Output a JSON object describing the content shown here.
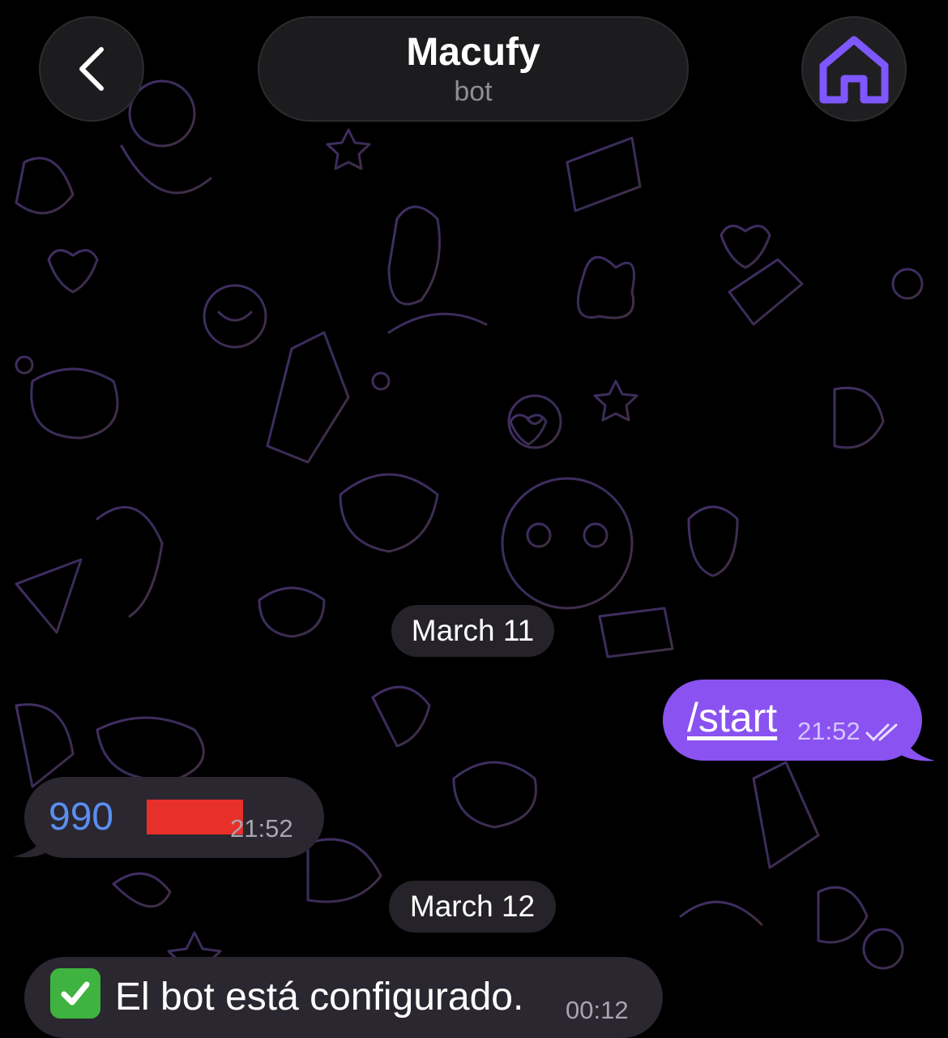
{
  "header": {
    "title": "Macufy",
    "subtitle": "bot",
    "back_icon": "chevron-left-icon",
    "home_icon": "home-icon",
    "accent_color": "#7e57ff"
  },
  "messages": [
    {
      "type": "date",
      "label": "March 11"
    },
    {
      "type": "outgoing",
      "text": "/start",
      "time": "21:52",
      "status": "read",
      "bubble_color": "#8a52f0"
    },
    {
      "type": "incoming",
      "text": "990",
      "time": "21:52",
      "redacted": true,
      "link_color": "#5b8ef0"
    },
    {
      "type": "date",
      "label": "March 12"
    },
    {
      "type": "incoming",
      "emoji": "white-check-mark",
      "text": "El bot está configurado.",
      "time": "00:12"
    }
  ]
}
